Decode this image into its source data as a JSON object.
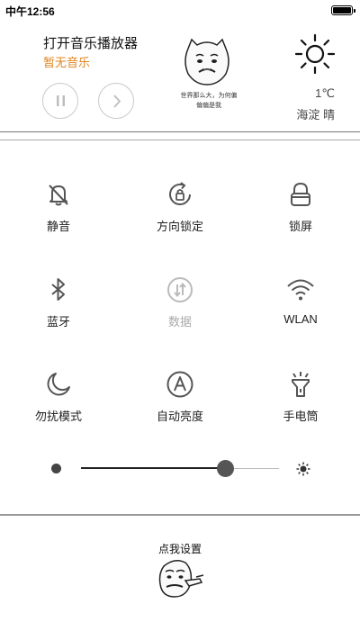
{
  "status_bar": {
    "time": "中午12:56"
  },
  "music": {
    "title": "打开音乐播放器",
    "subtitle": "暂无音乐",
    "pause_icon": "pause-icon",
    "next_icon": "chevron-right-icon"
  },
  "meme": {
    "caption_line1": "世界那么大，为何偏",
    "caption_line2": "偏偏是我"
  },
  "weather": {
    "icon": "sun-icon",
    "temperature": "1℃",
    "location": "海淀  晴"
  },
  "toggles": [
    {
      "label": "静音",
      "icon": "bell-off-icon",
      "enabled": true
    },
    {
      "label": "方向锁定",
      "icon": "rotation-lock-icon",
      "enabled": true
    },
    {
      "label": "锁屏",
      "icon": "lock-icon",
      "enabled": true
    },
    {
      "label": "蓝牙",
      "icon": "bluetooth-icon",
      "enabled": true
    },
    {
      "label": "数据",
      "icon": "mobile-data-icon",
      "enabled": false
    },
    {
      "label": "WLAN",
      "icon": "wifi-icon",
      "enabled": true
    },
    {
      "label": "勿扰模式",
      "icon": "moon-icon",
      "enabled": true
    },
    {
      "label": "自动亮度",
      "icon": "auto-brightness-icon",
      "enabled": true
    },
    {
      "label": "手电筒",
      "icon": "flashlight-icon",
      "enabled": true
    }
  ],
  "brightness": {
    "level_percent": 73,
    "low_icon": "dot-icon",
    "high_icon": "sun-small-icon"
  },
  "footer": {
    "settings_label": "点我设置"
  },
  "colors": {
    "accent_orange": "#e0851e",
    "icon_gray": "#555555",
    "disabled_gray": "#aaaaaa"
  }
}
